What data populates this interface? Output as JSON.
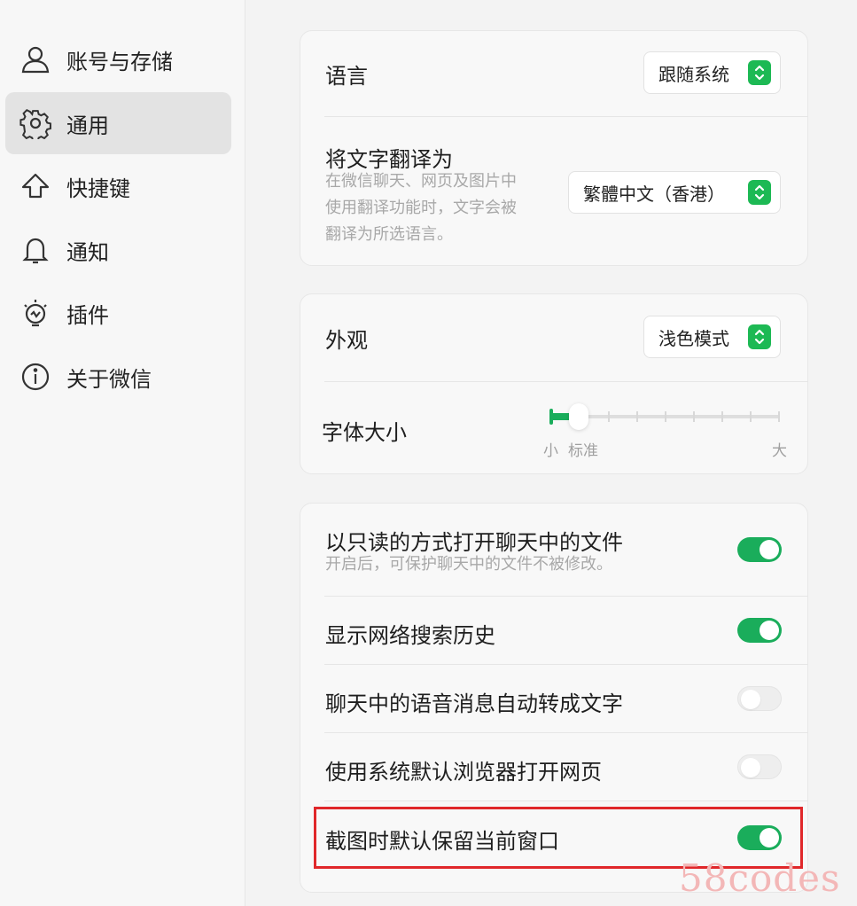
{
  "sidebar": {
    "items": [
      {
        "label": "账号与存储",
        "icon": "user-icon",
        "active": false
      },
      {
        "label": "通用",
        "icon": "gear-icon",
        "active": true
      },
      {
        "label": "快捷键",
        "icon": "arrow-up-icon",
        "active": false
      },
      {
        "label": "通知",
        "icon": "bell-icon",
        "active": false
      },
      {
        "label": "插件",
        "icon": "plugin-bulb-icon",
        "active": false
      },
      {
        "label": "关于微信",
        "icon": "info-icon",
        "active": false
      }
    ]
  },
  "language_card": {
    "language_label": "语言",
    "language_value": "跟随系统",
    "translate_label": "将文字翻译为",
    "translate_desc_1": "在微信聊天、网页及图片中",
    "translate_desc_2": "使用翻译功能时，文字会被",
    "translate_desc_3": "翻译为所选语言。",
    "translate_value": "繁體中文（香港）"
  },
  "appearance_card": {
    "appearance_label": "外观",
    "appearance_value": "浅色模式",
    "font_size_label": "字体大小",
    "font_size_min": "小",
    "font_size_standard": "标准",
    "font_size_max": "大",
    "font_size_level": 1,
    "font_size_levels": 9
  },
  "options_card": {
    "items": [
      {
        "label": "以只读的方式打开聊天中的文件",
        "desc": "开启后，可保护聊天中的文件不被修改。",
        "enabled": true
      },
      {
        "label": "显示网络搜索历史",
        "enabled": true
      },
      {
        "label": "聊天中的语音消息自动转成文字",
        "enabled": false
      },
      {
        "label": "使用系统默认浏览器打开网页",
        "enabled": false
      },
      {
        "label": "截图时默认保留当前窗口",
        "enabled": true
      }
    ]
  },
  "colors": {
    "accent": "#1aad5b",
    "highlight": "#e0272a"
  },
  "watermark": "58codes"
}
